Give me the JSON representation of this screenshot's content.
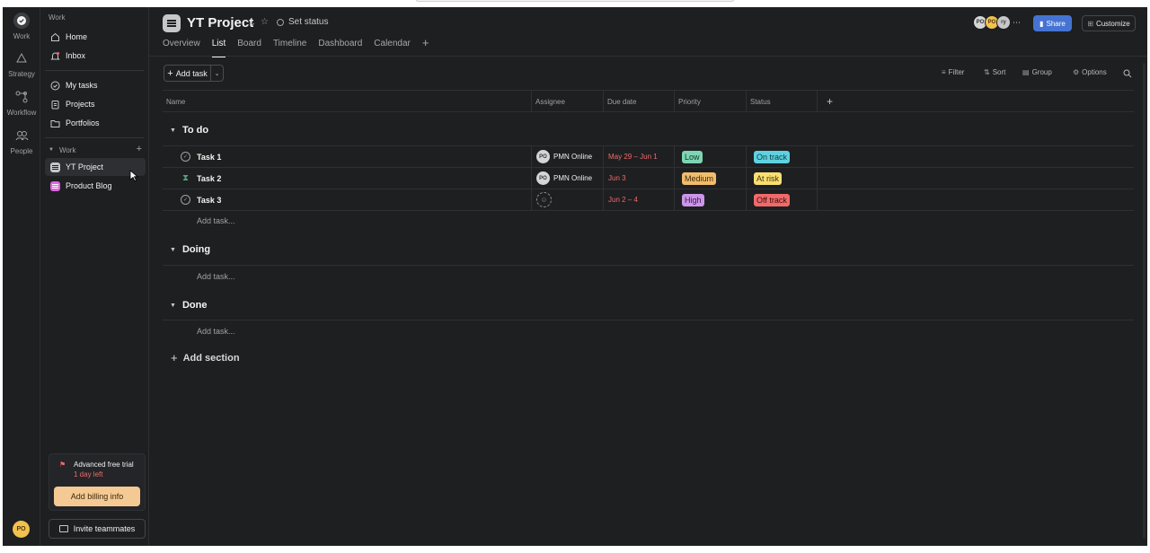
{
  "rail": {
    "items": [
      {
        "label": "Work"
      },
      {
        "label": "Strategy"
      },
      {
        "label": "Workflow"
      },
      {
        "label": "People"
      }
    ],
    "avatar_initials": "PO"
  },
  "sidebar": {
    "header": "Work",
    "nav": [
      {
        "label": "Home",
        "icon": "home-icon"
      },
      {
        "label": "Inbox",
        "icon": "bell-icon"
      },
      {
        "label": "My tasks",
        "icon": "check-circle-icon"
      },
      {
        "label": "Projects",
        "icon": "clipboard-icon"
      },
      {
        "label": "Portfolios",
        "icon": "folder-icon"
      }
    ],
    "section_label": "Work",
    "projects": [
      {
        "label": "YT Project",
        "color": "#c7c7c9"
      },
      {
        "label": "Product Blog",
        "color": "#e362e3"
      }
    ],
    "trial": {
      "title": "Advanced free trial",
      "days_left": "1 day left",
      "button": "Add billing info"
    },
    "invite": "Invite teammates"
  },
  "header": {
    "title": "YT Project",
    "set_status": "Set status",
    "tabs": [
      "Overview",
      "List",
      "Board",
      "Timeline",
      "Dashboard",
      "Calendar"
    ],
    "active_tab": "List",
    "avatars": [
      "PO",
      "PO",
      "ry"
    ],
    "share": "Share",
    "customize": "Customize"
  },
  "toolbar": {
    "add_task": "Add task",
    "filter": "Filter",
    "sort": "Sort",
    "group": "Group",
    "options": "Options"
  },
  "table": {
    "columns": [
      "Name",
      "Assignee",
      "Due date",
      "Priority",
      "Status"
    ],
    "sections": [
      {
        "title": "To do",
        "add_task": "Add task...",
        "tasks": [
          {
            "name": "Task 1",
            "icon": "check-circle-icon",
            "assignee": "PMN Online",
            "assignee_initials": "PO",
            "due": "May 29 – Jun 1",
            "priority": "Low",
            "priority_color": "#7dd6b3",
            "status": "On track",
            "status_color": "#5fd2e0"
          },
          {
            "name": "Task 2",
            "icon": "hourglass-icon",
            "assignee": "PMN Online",
            "assignee_initials": "PO",
            "due": "Jun 3",
            "priority": "Medium",
            "priority_color": "#f1bd6c",
            "status": "At risk",
            "status_color": "#f8df72"
          },
          {
            "name": "Task 3",
            "icon": "check-circle-icon",
            "assignee": "",
            "assignee_initials": "",
            "due": "Jun 2 – 4",
            "priority": "High",
            "priority_color": "#cd95ea",
            "status": "Off track",
            "status_color": "#f06a6a"
          }
        ]
      },
      {
        "title": "Doing",
        "add_task": "Add task...",
        "tasks": []
      },
      {
        "title": "Done",
        "add_task": "Add task...",
        "tasks": []
      }
    ],
    "add_section": "Add section"
  }
}
